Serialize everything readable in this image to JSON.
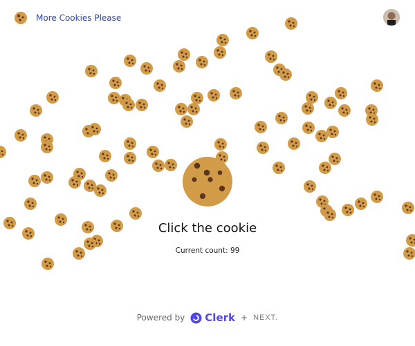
{
  "header": {
    "brand_label": "More Cookies Please",
    "brand_icon": "cookie-icon",
    "avatar_icon": "user-avatar"
  },
  "main": {
    "title": "Click the cookie",
    "count_label": "Current count: 99"
  },
  "footer": {
    "powered_by": "Powered by",
    "clerk_label": "Clerk",
    "plus": "+",
    "next_label": "NEXT."
  },
  "colors": {
    "brand_link": "#2b45c8",
    "cookie": "#d29b48",
    "cookie_chip": "#5a3520",
    "clerk": "#4f46e5"
  }
}
